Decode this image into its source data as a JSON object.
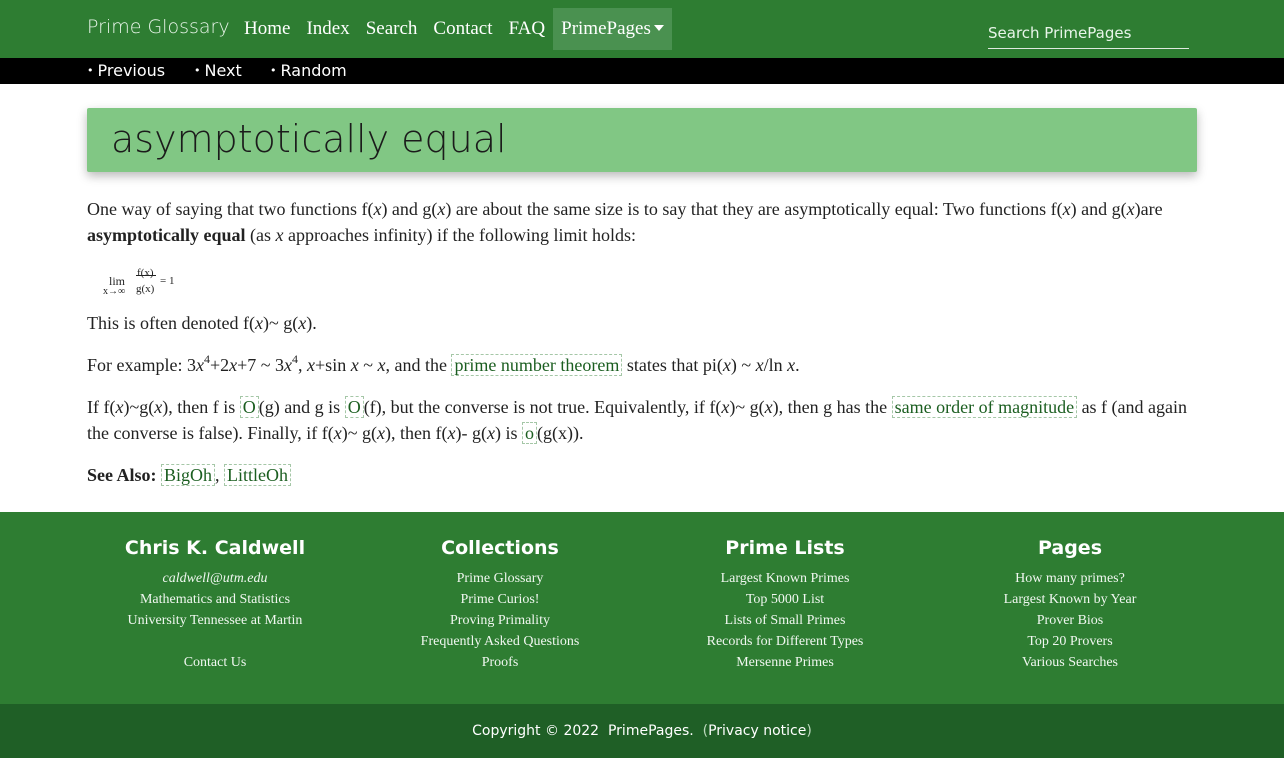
{
  "nav": {
    "brand": "Prime Glossary",
    "links": [
      "Home",
      "Index",
      "Search",
      "Contact",
      "FAQ"
    ],
    "dropdown_label": "PrimePages",
    "search_placeholder": "Search PrimePages"
  },
  "subnav": {
    "bullet": "•",
    "previous": "Previous",
    "next": "Next",
    "random": "Random"
  },
  "page": {
    "title": "asymptotically equal"
  },
  "body": {
    "p1_a": "One way of saying that two functions f(",
    "x": "x",
    "p1_b": ") and g(",
    "p1_c": ") are about the same size is to say that they are asymptotically equal: Two functions f(",
    "p1_d": ") and g(",
    "p1_e": ")are",
    "p1_bold": "asymptotically equal",
    "p1_f": " (as ",
    "p1_g": " approaches infinity) if the following limit holds:",
    "formula": {
      "lim": "lim",
      "lim_sub": "x→∞",
      "num": "f(x)",
      "den": "g(x)",
      "eq": "= 1"
    },
    "p2_a": "This is often denoted f(",
    "p2_b": ")~ g(",
    "p2_c": ").",
    "p3_a": "For example: 3",
    "p3_exp": "4",
    "p3_b": "+2",
    "p3_c": "+7 ~ 3",
    "p3_d": ", ",
    "p3_e": "+sin ",
    "p3_f": " ~ ",
    "p3_g": ", and the ",
    "p3_link": "prime number theorem",
    "p3_h": " states that pi(",
    "p3_i": ") ~ ",
    "p3_j": "/ln ",
    "p3_k": ".",
    "p4_a": "If f(",
    "p4_b": ")~g(",
    "p4_c": "), then f is ",
    "link_O": "O",
    "p4_d": "(g) and g is ",
    "p4_e": "(f), but the converse is not true. Equivalently, if f(",
    "p4_f": ")~ g(",
    "p4_g": "), then g has the ",
    "p4_link_som": "same order of magnitude",
    "p4_h": " as f (and again the converse is false). Finally, if f(",
    "p4_i": ")~ g(",
    "p4_j": "), then f(",
    "p4_k": ")- g(",
    "p4_l": ") is ",
    "link_o": "o",
    "p4_m": "(g(x)).",
    "see_also_label": "See Also:",
    "see_also": [
      "BigOh",
      "LittleOh"
    ],
    "comma": ", "
  },
  "footer": {
    "col1": {
      "title": "Chris K. Caldwell",
      "email": "caldwell@utm.edu",
      "dept": "Mathematics and Statistics",
      "univ": "University Tennessee at Martin",
      "contact": "Contact Us"
    },
    "col2": {
      "title": "Collections",
      "items": [
        "Prime Glossary",
        "Prime Curios!",
        "Proving Primality",
        "Frequently Asked Questions",
        "Proofs"
      ]
    },
    "col3": {
      "title": "Prime Lists",
      "items": [
        "Largest Known Primes",
        "Top 5000 List",
        "Lists of Small Primes",
        "Records for Different Types",
        "Mersenne Primes"
      ]
    },
    "col4": {
      "title": "Pages",
      "items": [
        "How many primes?",
        "Largest Known by Year",
        "Prover Bios",
        "Top 20 Provers",
        "Various Searches"
      ]
    }
  },
  "copyright": {
    "text": "Copyright © 2022",
    "site": "PrimePages",
    "dot": ".",
    "paren_open": "(",
    "privacy": "Privacy notice",
    "paren_close": ")"
  }
}
